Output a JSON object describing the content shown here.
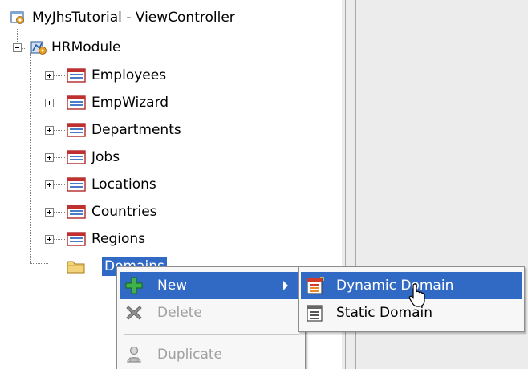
{
  "tree": {
    "root": {
      "label": "MyJhsTutorial - ViewController",
      "icon": "project-icon"
    },
    "module": {
      "label": "HRModule",
      "icon": "module-icon"
    },
    "items": [
      {
        "label": "Employees",
        "icon": "table-icon"
      },
      {
        "label": "EmpWizard",
        "icon": "table-icon"
      },
      {
        "label": "Departments",
        "icon": "table-icon"
      },
      {
        "label": "Jobs",
        "icon": "table-icon"
      },
      {
        "label": "Locations",
        "icon": "table-icon"
      },
      {
        "label": "Countries",
        "icon": "table-icon"
      },
      {
        "label": "Regions",
        "icon": "table-icon"
      }
    ],
    "selected_folder": {
      "label": "Domains",
      "icon": "folder-icon"
    }
  },
  "context_menu": {
    "items": [
      {
        "label": "New",
        "icon": "add-icon",
        "state": "highlighted",
        "has_submenu": true
      },
      {
        "label": "Delete",
        "icon": "delete-icon",
        "state": "disabled"
      },
      {
        "label": "Duplicate",
        "icon": "duplicate-icon",
        "state": "disabled"
      }
    ]
  },
  "submenu": {
    "items": [
      {
        "label": "Dynamic Domain",
        "icon": "dynamic-domain-icon",
        "state": "highlighted"
      },
      {
        "label": "Static Domain",
        "icon": "static-domain-icon",
        "state": "normal"
      }
    ]
  },
  "colors": {
    "selection": "#316ac5",
    "menu_background": "#f7f7f7",
    "pane_background": "#ececec",
    "disabled_text": "#a0a0a0"
  }
}
